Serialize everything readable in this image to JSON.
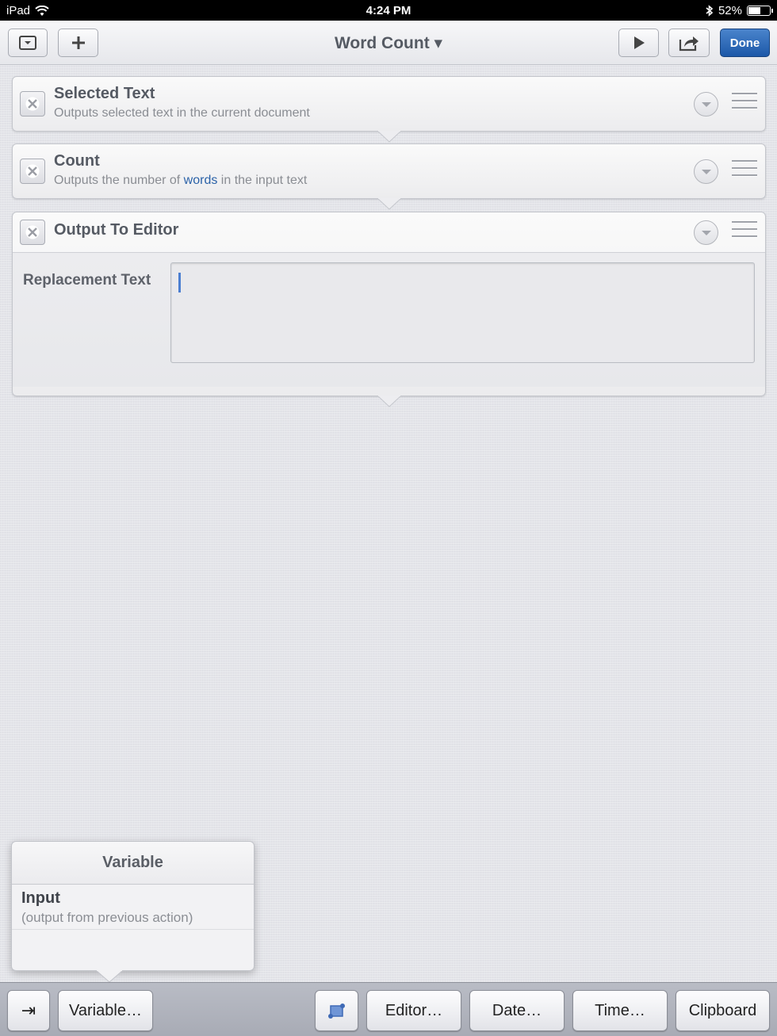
{
  "status_bar": {
    "device": "iPad",
    "time": "4:24 PM",
    "battery": "52%",
    "battery_level": 0.52
  },
  "toolbar": {
    "title": "Word Count ▾",
    "done_label": "Done",
    "icons": [
      "collapse-icon",
      "plus-icon",
      "play-icon",
      "share-icon"
    ]
  },
  "actions": [
    {
      "title": "Selected Text",
      "subtitle": "Outputs selected text in the current document"
    },
    {
      "title": "Count",
      "subtitle_pre": "Outputs the number of ",
      "subtitle_link": "words",
      "subtitle_post": " in the input text"
    },
    {
      "title": "Output To Editor",
      "field_label": "Replacement Text",
      "field_value": ""
    }
  ],
  "popover": {
    "title": "Variable",
    "items": [
      {
        "name": "Input",
        "description": "(output from previous action)"
      }
    ]
  },
  "bottom_bar": {
    "tab_glyph": "⇥",
    "variable_label": "Variable…",
    "editor_label": "Editor…",
    "date_label": "Date…",
    "time_label": "Time…",
    "clipboard_label": "Clipboard"
  },
  "colors": {
    "accent": "#1c58a8",
    "link": "#2b62a8",
    "caret": "#4c7fd1"
  }
}
